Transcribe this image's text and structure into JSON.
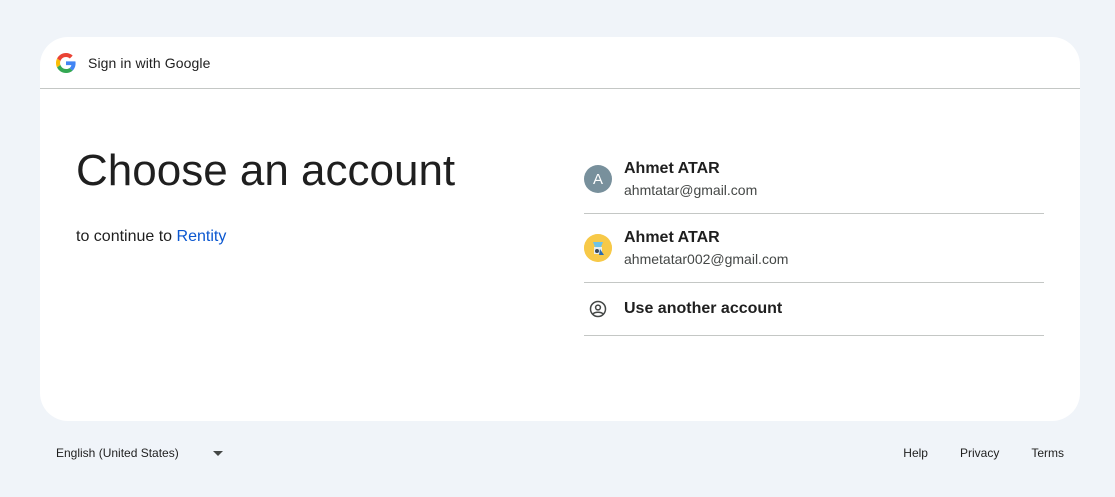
{
  "header": {
    "title": "Sign in with Google",
    "logo_icon": "google-g-icon"
  },
  "main": {
    "title": "Choose an account",
    "subtitle_prefix": "to continue to ",
    "app_name": "Rentity"
  },
  "accounts": [
    {
      "avatar_type": "letter",
      "avatar_letter": "A",
      "avatar_color": "#78909c",
      "name": "Ahmet ATAR",
      "email": "ahmtatar@gmail.com"
    },
    {
      "avatar_type": "image",
      "avatar_color": "#f7c948",
      "name": "Ahmet ATAR",
      "email": "ahmetatar002@gmail.com"
    }
  ],
  "use_another": {
    "label": "Use another account",
    "icon": "account-circle-icon"
  },
  "footer": {
    "language": "English (United States)",
    "links": {
      "help": "Help",
      "privacy": "Privacy",
      "terms": "Terms"
    }
  },
  "colors": {
    "background": "#f0f4f9",
    "card": "#ffffff",
    "link": "#0b57d0",
    "divider": "#c4c7c5"
  }
}
